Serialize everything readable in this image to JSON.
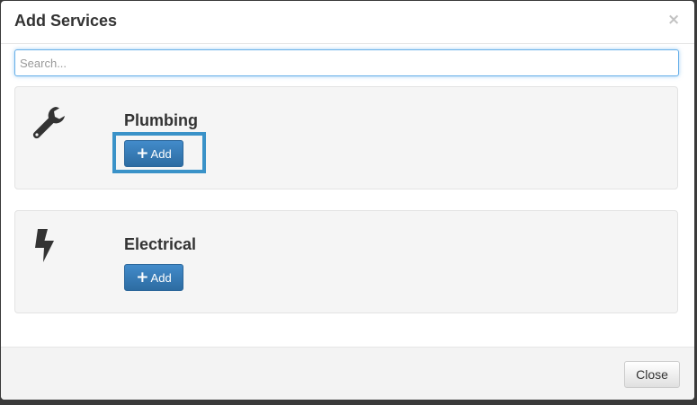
{
  "modal": {
    "title": "Add Services",
    "close_glyph": "×"
  },
  "search": {
    "placeholder": "Search...",
    "value": ""
  },
  "services": [
    {
      "name": "Plumbing",
      "icon": "wrench-icon",
      "add_label": "Add",
      "highlighted": true
    },
    {
      "name": "Electrical",
      "icon": "lightning-bolt-icon",
      "add_label": "Add",
      "highlighted": false
    }
  ],
  "add_button_glyph": "+",
  "footer": {
    "close_label": "Close"
  },
  "colors": {
    "primary": "#3a7bc8",
    "highlight_border": "#3a92c8",
    "well_background": "#f5f5f5"
  }
}
